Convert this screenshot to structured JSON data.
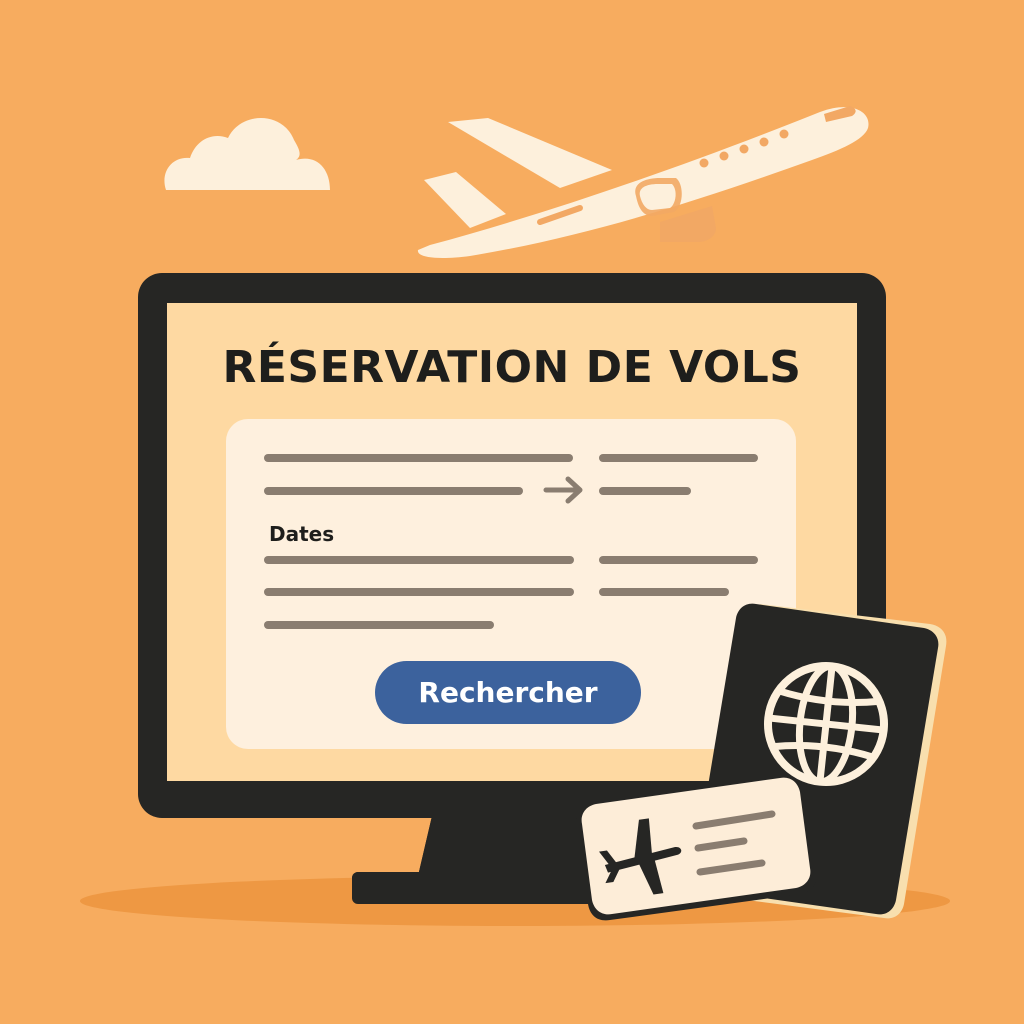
{
  "page": {
    "title": "RÉSERVATION DE VOLS",
    "dates_label": "Dates",
    "search_button_label": "Rechercher"
  },
  "colors": {
    "background": "#F7AC5F",
    "monitor_frame": "#262624",
    "screen": "#FED9A2",
    "form_card": "#FEF0DE",
    "form_lines": "#8A7D70",
    "button": "#3C629D",
    "button_text": "#FFFFFF",
    "airplane": "#FDF0DC",
    "airplane_accent": "#F2A864",
    "cloud": "#FDF0DC",
    "passport": "#262624",
    "passport_edge": "#F8DFAE",
    "ticket": "#FDEDD8"
  },
  "icons": {
    "header_plane": "airplane-icon",
    "header_cloud": "cloud-icon",
    "form_arrow": "arrow-right-icon",
    "passport_emblem": "globe-icon",
    "ticket_plane": "airplane-icon"
  }
}
